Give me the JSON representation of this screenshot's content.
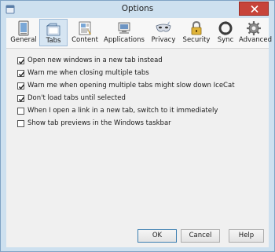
{
  "window": {
    "title": "Options"
  },
  "toolbar": {
    "panes": [
      {
        "label": "General",
        "icon": "general-icon",
        "selected": false
      },
      {
        "label": "Tabs",
        "icon": "tabs-icon",
        "selected": true
      },
      {
        "label": "Content",
        "icon": "content-icon",
        "selected": false
      },
      {
        "label": "Applications",
        "icon": "applications-icon",
        "selected": false
      },
      {
        "label": "Privacy",
        "icon": "privacy-mask-icon",
        "selected": false
      },
      {
        "label": "Security",
        "icon": "padlock-icon",
        "selected": false
      },
      {
        "label": "Sync",
        "icon": "sync-icon",
        "selected": false
      },
      {
        "label": "Advanced",
        "icon": "gear-icon",
        "selected": false
      }
    ]
  },
  "tabs_options": [
    {
      "label": "Open new windows in a new tab instead",
      "checked": true
    },
    {
      "label": "Warn me when closing multiple tabs",
      "checked": true
    },
    {
      "label": "Warn me when opening multiple tabs might slow down IceCat",
      "checked": true
    },
    {
      "label": "Don't load tabs until selected",
      "checked": true
    },
    {
      "label": "When I open a link in a new tab, switch to it immediately",
      "checked": false
    },
    {
      "label": "Show tab previews in the Windows taskbar",
      "checked": false
    }
  ],
  "buttons": {
    "ok": "OK",
    "cancel": "Cancel",
    "help": "Help"
  },
  "colors": {
    "frame": "#cde0ef",
    "close_button": "#c7443a",
    "selected_pane": "#d6e5f2",
    "dialog_bg": "#f0f0f0"
  }
}
